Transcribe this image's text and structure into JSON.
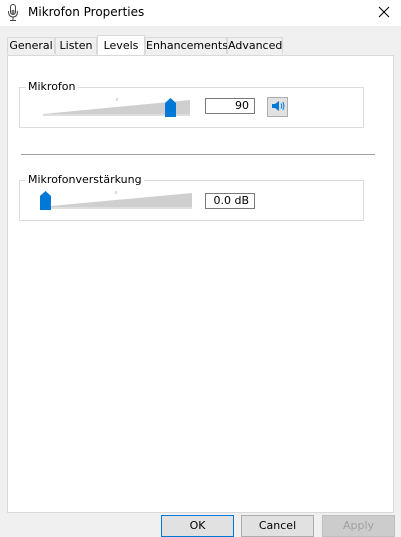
{
  "window": {
    "title": "Mikrofon Properties",
    "icon": "microphone-icon",
    "close_icon": "close-icon"
  },
  "tabs": [
    {
      "label": "General",
      "active": false
    },
    {
      "label": "Listen",
      "active": false
    },
    {
      "label": "Levels",
      "active": true
    },
    {
      "label": "Enhancements",
      "active": false
    },
    {
      "label": "Advanced",
      "active": false
    }
  ],
  "levels": {
    "microphone": {
      "label": "Mikrofon",
      "value": "90",
      "slider_level": 0.9,
      "mute_icon": "speaker-icon"
    },
    "boost": {
      "label": "Mikrofonverstärkung",
      "value": "0.0 dB",
      "slider_level": 0.0
    }
  },
  "buttons": {
    "ok": "OK",
    "cancel": "Cancel",
    "apply": "Apply"
  },
  "colors": {
    "accent": "#0078d7",
    "slider_track": "#cfcfcf"
  }
}
